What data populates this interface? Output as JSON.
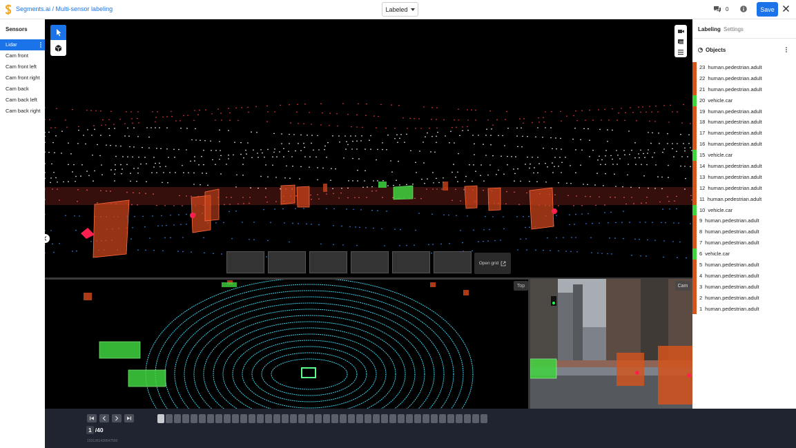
{
  "header": {
    "breadcrumb_org": "Segments.ai",
    "breadcrumb_sep": " / ",
    "breadcrumb_dataset": "Multi-sensor labeling",
    "status_select": "Labeled",
    "comment_count": "0",
    "save_label": "Save",
    "brand_color": "#f5a623",
    "accent_color": "#1a73e8"
  },
  "sidebar": {
    "title": "Sensors",
    "items": [
      {
        "label": "Lidar",
        "active": true
      },
      {
        "label": "Cam front"
      },
      {
        "label": "Cam front left"
      },
      {
        "label": "Cam front right"
      },
      {
        "label": "Cam back"
      },
      {
        "label": "Cam back left"
      },
      {
        "label": "Cam back right"
      }
    ]
  },
  "viewer": {
    "open_grid_label": "Open grid",
    "top_view_label": "Top",
    "cam_view_label": "Cam",
    "tools": [
      "cursor-icon",
      "cuboid-icon"
    ],
    "view_tools": [
      "camera-icon",
      "layers-icon",
      "list-icon"
    ]
  },
  "panel": {
    "tab_labeling": "Labeling",
    "tab_settings": "Settings",
    "objects_title": "Objects",
    "objects": [
      {
        "id": "23",
        "label": "human.pedestrian.adult",
        "color": "#d4541c"
      },
      {
        "id": "22",
        "label": "human.pedestrian.adult",
        "color": "#d4541c"
      },
      {
        "id": "21",
        "label": "human.pedestrian.adult",
        "color": "#d4541c"
      },
      {
        "id": "20",
        "label": "vehicle.car",
        "color": "#3fd43f"
      },
      {
        "id": "19",
        "label": "human.pedestrian.adult",
        "color": "#d4541c"
      },
      {
        "id": "18",
        "label": "human.pedestrian.adult",
        "color": "#d4541c"
      },
      {
        "id": "17",
        "label": "human.pedestrian.adult",
        "color": "#d4541c"
      },
      {
        "id": "16",
        "label": "human.pedestrian.adult",
        "color": "#d4541c"
      },
      {
        "id": "15",
        "label": "vehicle.car",
        "color": "#3fd43f"
      },
      {
        "id": "14",
        "label": "human.pedestrian.adult",
        "color": "#d4541c"
      },
      {
        "id": "13",
        "label": "human.pedestrian.adult",
        "color": "#d4541c"
      },
      {
        "id": "12",
        "label": "human.pedestrian.adult",
        "color": "#d4541c"
      },
      {
        "id": "11",
        "label": "human.pedestrian.adult",
        "color": "#d4541c"
      },
      {
        "id": "10",
        "label": "vehicle.car",
        "color": "#3fd43f"
      },
      {
        "id": "9",
        "label": "human.pedestrian.adult",
        "color": "#d4541c"
      },
      {
        "id": "8",
        "label": "human.pedestrian.adult",
        "color": "#d4541c"
      },
      {
        "id": "7",
        "label": "human.pedestrian.adult",
        "color": "#d4541c"
      },
      {
        "id": "6",
        "label": "vehicle.car",
        "color": "#3fd43f"
      },
      {
        "id": "5",
        "label": "human.pedestrian.adult",
        "color": "#d4541c"
      },
      {
        "id": "4",
        "label": "human.pedestrian.adult",
        "color": "#d4541c"
      },
      {
        "id": "3",
        "label": "human.pedestrian.adult",
        "color": "#d4541c"
      },
      {
        "id": "2",
        "label": "human.pedestrian.adult",
        "color": "#d4541c"
      },
      {
        "id": "1",
        "label": "human.pedestrian.adult",
        "color": "#d4541c"
      }
    ]
  },
  "timeline": {
    "current_frame": "1",
    "total_frames": "/40",
    "frame_count": 40,
    "frame_id": "1531281439547590"
  }
}
